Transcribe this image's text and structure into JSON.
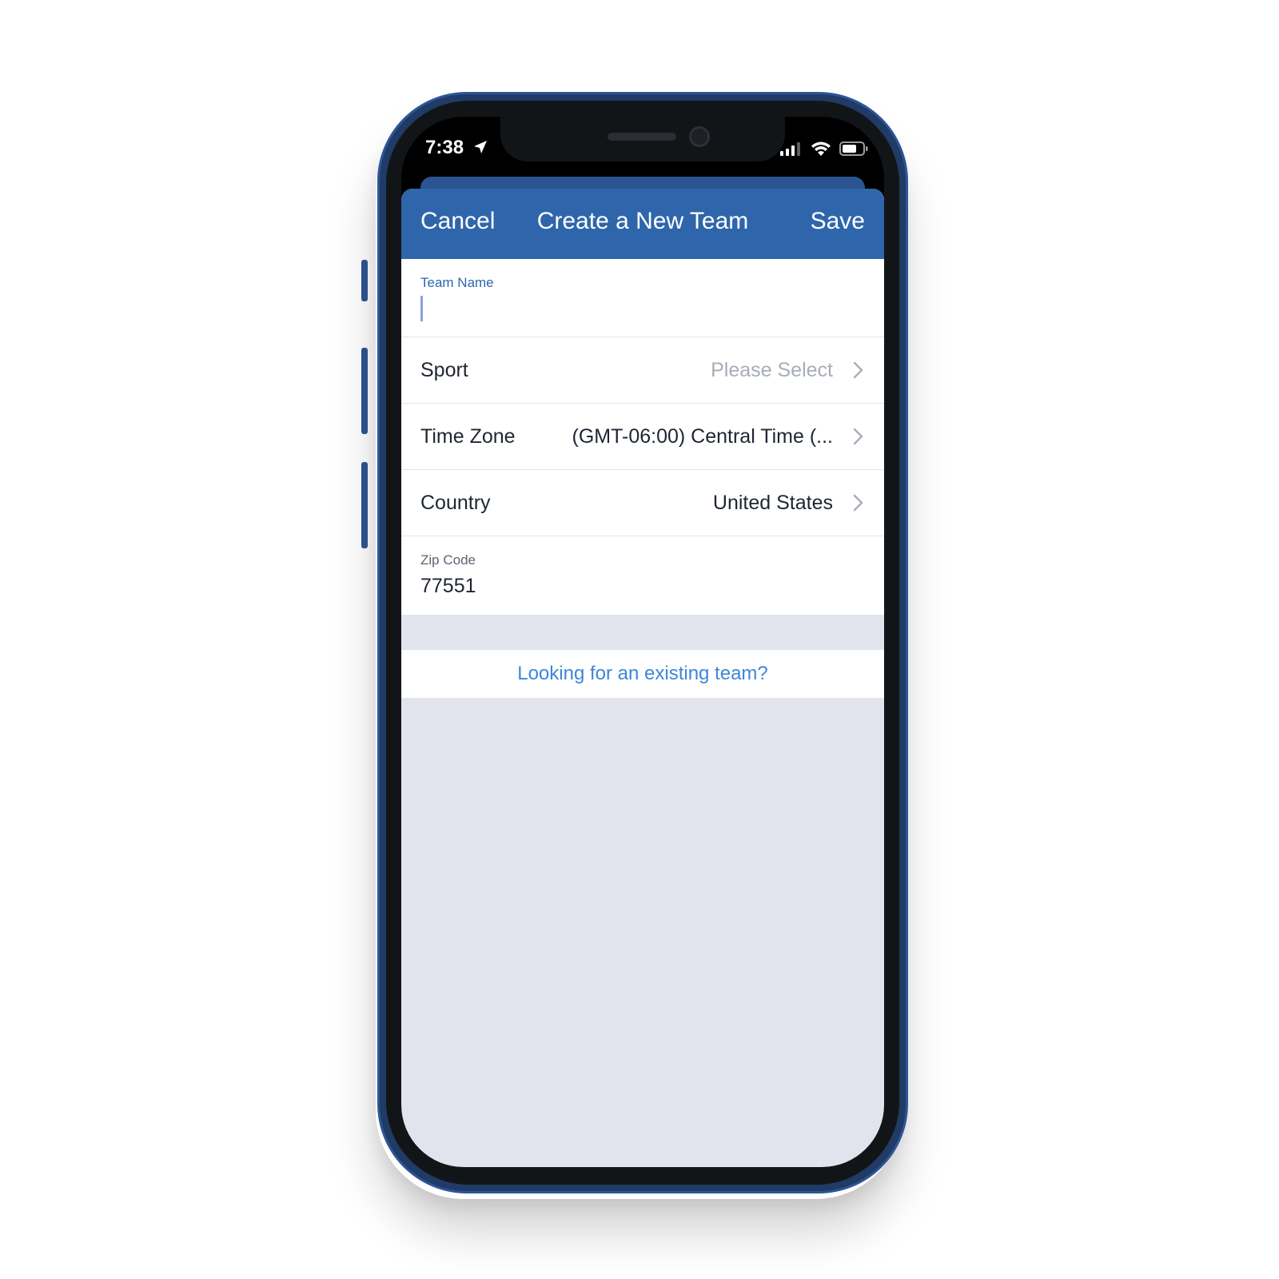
{
  "status_bar": {
    "time": "7:38",
    "location_icon": "location-arrow-icon",
    "signal_icon": "cellular-signal-icon",
    "wifi_icon": "wifi-icon",
    "battery_icon": "battery-icon"
  },
  "nav": {
    "cancel_label": "Cancel",
    "title": "Create a New Team",
    "save_label": "Save"
  },
  "form": {
    "team_name": {
      "label": "Team Name",
      "value": ""
    },
    "sport": {
      "label": "Sport",
      "value": "Please Select"
    },
    "time_zone": {
      "label": "Time Zone",
      "value": "(GMT-06:00) Central Time (..."
    },
    "country": {
      "label": "Country",
      "value": "United States"
    },
    "zip_code": {
      "label": "Zip Code",
      "value": "77551"
    }
  },
  "existing_team_link": "Looking for an existing team?",
  "colors": {
    "nav_blue": "#2f66ab",
    "link_blue": "#3c87d9",
    "background_gray": "#e1e4ec",
    "phone_frame": "#1f3b66"
  }
}
